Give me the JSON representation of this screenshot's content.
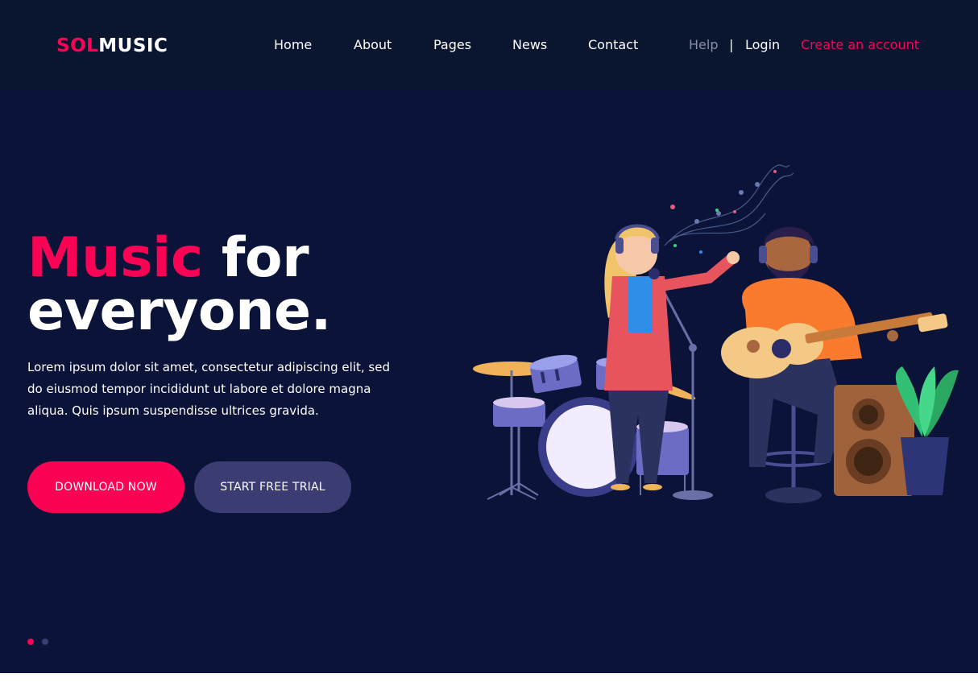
{
  "brand": {
    "part1": "SOL",
    "part2": "MUSIC"
  },
  "nav": {
    "items": [
      "Home",
      "About",
      "Pages",
      "News",
      "Contact"
    ],
    "help": "Help",
    "separator": "|",
    "login": "Login",
    "create_account": "Create an account"
  },
  "hero": {
    "title_accent": "Music",
    "title_rest_1": " for",
    "title_line2": "everyone.",
    "description": "Lorem ipsum dolor sit amet, consectetur adipiscing elit, sed do eiusmod tempor incididunt ut labore et dolore magna aliqua. Quis ipsum suspendisse ultrices gravida.",
    "primary_button": "DOWNLOAD NOW",
    "secondary_button": "START FREE TRIAL"
  },
  "slider": {
    "active_index": 0,
    "count": 2
  },
  "colors": {
    "accent": "#fc0254",
    "background": "#0b1438",
    "header": "#0a1530",
    "secondary_button": "#3b3c72"
  },
  "illustration": {
    "icon": "music-band-illustration"
  }
}
